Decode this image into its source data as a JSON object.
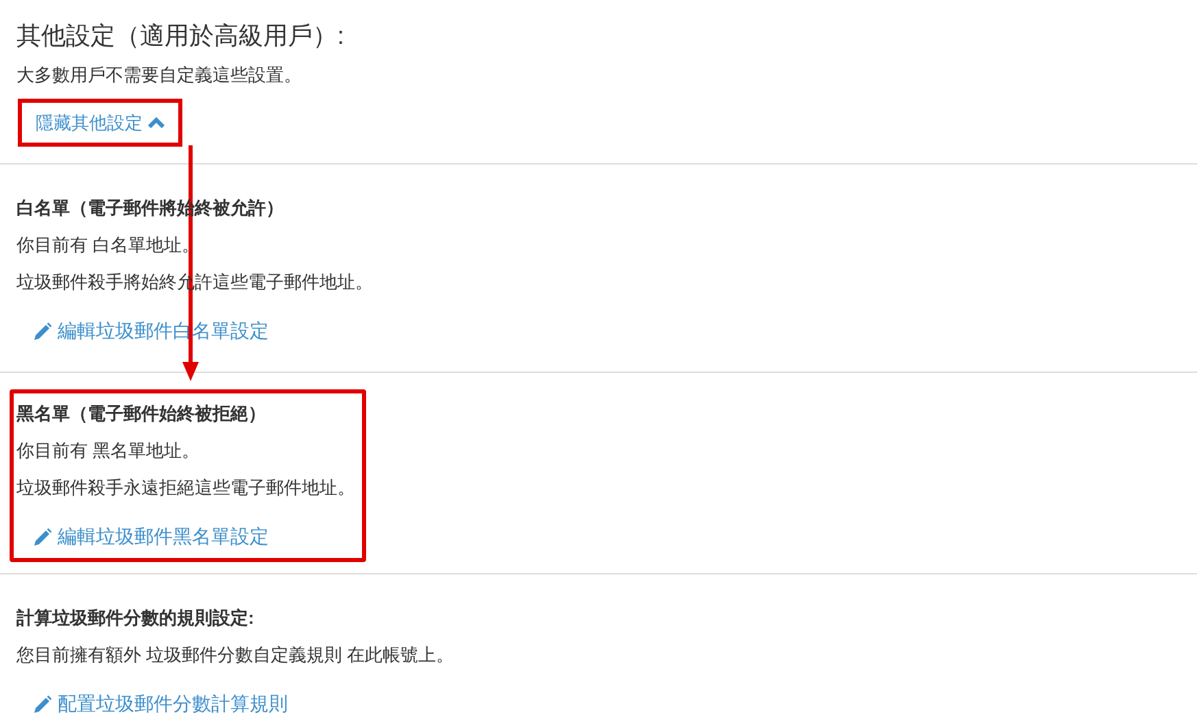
{
  "heading": "其他設定（適用於高級用戶）:",
  "subtitle": "大多數用戶不需要自定義這些設置。",
  "toggle": {
    "label": "隱藏其他設定",
    "expanded": true,
    "highlighted": true
  },
  "arrow": true,
  "sections": [
    {
      "title": "白名單（電子郵件將**始終被允許**）",
      "lines": [
        "你目前有 白名單地址。",
        "垃圾郵件殺手將始終允許這些電子郵件地址。"
      ],
      "link": "編輯垃圾郵件白名單設定",
      "highlighted": false
    },
    {
      "title": "黑名單（電子郵件**始終被拒絕**）",
      "lines": [
        "你目前有 黑名單地址。",
        "垃圾郵件殺手永遠拒絕這些電子郵件地址。"
      ],
      "link": "編輯垃圾郵件黑名單設定",
      "highlighted": true
    },
    {
      "title": "計算垃圾郵件分數的規則設定:",
      "lines": [
        "您目前擁有額外 垃圾郵件分數自定義規則 在此帳號上。"
      ],
      "link": "配置垃圾郵件分數計算規則",
      "highlighted": false
    }
  ]
}
